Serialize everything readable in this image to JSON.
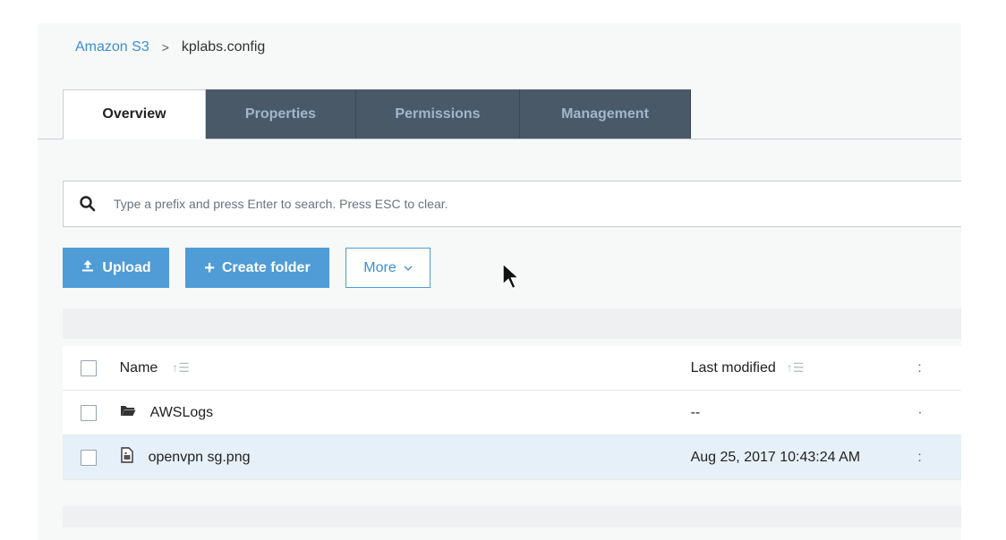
{
  "breadcrumb": {
    "root": "Amazon S3",
    "separator": ">",
    "current": "kplabs.config"
  },
  "tabs": [
    {
      "label": "Overview",
      "active": true
    },
    {
      "label": "Properties",
      "active": false
    },
    {
      "label": "Permissions",
      "active": false
    },
    {
      "label": "Management",
      "active": false
    }
  ],
  "search": {
    "placeholder": "Type a prefix and press Enter to search. Press ESC to clear.",
    "value": ""
  },
  "actions": {
    "upload_label": "Upload",
    "create_folder_label": "Create folder",
    "more_label": "More"
  },
  "table": {
    "columns": {
      "name": "Name",
      "last_modified": "Last modified"
    },
    "rows": [
      {
        "name": "AWSLogs",
        "type": "folder",
        "last_modified": "--",
        "selected": false
      },
      {
        "name": "openvpn sg.png",
        "type": "file",
        "last_modified": "Aug 25, 2017 10:43:24 AM",
        "selected": true
      }
    ]
  },
  "colors": {
    "accent": "#4f9cd6",
    "tab_inactive_bg": "#4a5967",
    "selected_row_bg": "#e6f0f8"
  }
}
